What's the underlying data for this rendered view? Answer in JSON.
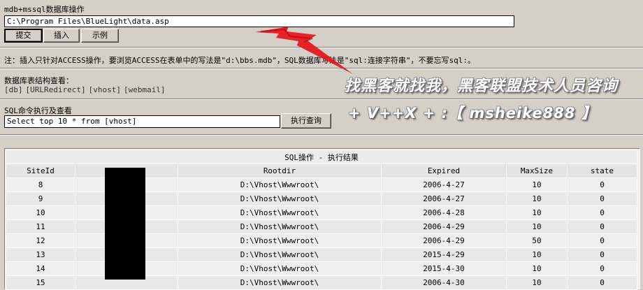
{
  "page": {
    "title": "mdb+mssql数据库操作",
    "db_path_value": "C:\\Program Files\\BlueLight\\data.asp",
    "buttons": {
      "submit": "提交",
      "insert": "插入",
      "example": "示例"
    },
    "note": "注：插入只针对ACCESS操作，要浏览ACCESS在表单中的写法是\"d:\\bbs.mdb\"，SQL数据库写法是\"sql:连接字符串\"，不要忘写sql:。"
  },
  "structure": {
    "title": "数据库表结构查看：",
    "links": [
      "[db]",
      "[URLRedirect]",
      "[vhost]",
      "[webmail]"
    ]
  },
  "sql": {
    "title": "SQL命令执行及查看",
    "query_value": "Select top 10 * from [vhost]",
    "execute_label": "执行查询"
  },
  "overlay": {
    "line1": "找黑客就找我，黑客联盟技术人员咨询",
    "line2": "+ V++X + :【 msheike888 】"
  },
  "results": {
    "caption": "SQL操作 - 执行结果",
    "columns": [
      "SiteId",
      "",
      "Rootdir",
      "Expired",
      "MaxSize",
      "state"
    ],
    "rows": [
      [
        "8",
        "",
        "D:\\Vhost\\Wwwroot\\",
        "2006-4-27",
        "10",
        "0"
      ],
      [
        "9",
        "",
        "D:\\Vhost\\Wwwroot\\",
        "2006-4-27",
        "10",
        "0"
      ],
      [
        "10",
        "",
        "D:\\Vhost\\Wwwroot\\",
        "2006-4-28",
        "10",
        "0"
      ],
      [
        "11",
        "",
        "D:\\Vhost\\Wwwroot\\",
        "2006-4-29",
        "10",
        "0"
      ],
      [
        "12",
        "",
        "D:\\Vhost\\Wwwroot\\",
        "2006-4-29",
        "50",
        "0"
      ],
      [
        "13",
        "",
        "D:\\Vhost\\Wwwroot\\",
        "2015-4-29",
        "10",
        "0"
      ],
      [
        "14",
        "",
        "D:\\Vhost\\Wwwroot\\",
        "2015-4-30",
        "10",
        "0"
      ],
      [
        "15",
        "",
        "D:\\Vhost\\Wwwroot\\",
        "2006-4-30",
        "10",
        "0"
      ]
    ]
  },
  "colors": {
    "background": "#d4d0c8",
    "arrow": "#e8141c",
    "table_bg": "#e8e8e6"
  }
}
